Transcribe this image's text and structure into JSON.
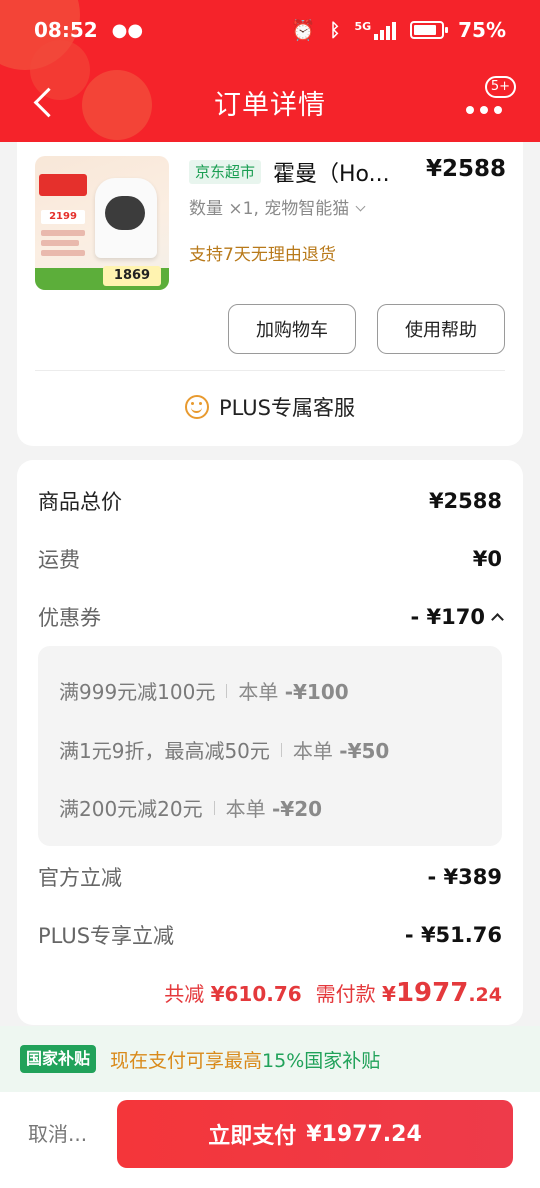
{
  "status_bar": {
    "time": "08:52",
    "network": "5G",
    "battery": "75%"
  },
  "nav": {
    "title": "订单详情",
    "badge": "5+"
  },
  "product": {
    "shop_tag": "京东超市",
    "name": "霍曼（Ho...",
    "price": "¥2588",
    "spec": "数量 ×1, 宠物智能猫",
    "return_policy": "支持7天无理由退货",
    "thumb_price": "1869",
    "thumb_price_small": "2199"
  },
  "actions": {
    "add_cart": "加购物车",
    "help": "使用帮助",
    "plus_service": "PLUS专属客服"
  },
  "price_detail": {
    "goods_total_label": "商品总价",
    "goods_total": "¥2588",
    "shipping_label": "运费",
    "shipping": "¥0",
    "coupon_label": "优惠券",
    "coupon_total": "- ¥170",
    "coupons": [
      {
        "rule": "满999元减100元",
        "applied_label": "本单",
        "applied": "-¥100"
      },
      {
        "rule": "满1元9折，最高减50元",
        "applied_label": "本单",
        "applied": "-¥50"
      },
      {
        "rule": "满200元减20元",
        "applied_label": "本单",
        "applied": "-¥20"
      }
    ],
    "official_discount_label": "官方立减",
    "official_discount": "- ¥389",
    "plus_discount_label": "PLUS专享立减",
    "plus_discount": "- ¥51.76",
    "total_saved_label": "共减",
    "total_saved": "¥610.76",
    "payable_label": "需付款",
    "payable_currency": "¥",
    "payable_int": "1977",
    "payable_dec": ".24"
  },
  "subsidy": {
    "tag": "国家补贴",
    "text_prefix": "现在支付可享最高",
    "text_highlight": "15%",
    "text_suffix": "国家补贴"
  },
  "bottom": {
    "cancel": "取消...",
    "pay_label": "立即支付",
    "pay_amount": "¥1977.24"
  },
  "colors": {
    "brand_red": "#f5232a",
    "price_red": "#e4393c",
    "green": "#21a25a",
    "gold": "#b8791a"
  }
}
